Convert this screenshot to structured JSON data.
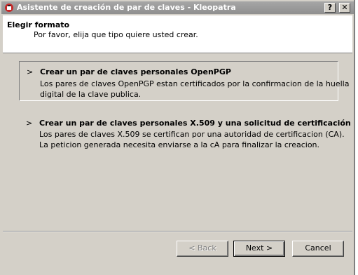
{
  "window": {
    "title": "Asistente de creación de par de claves - Kleopatra",
    "help_label": "?",
    "close_label": "✕"
  },
  "header": {
    "title": "Elegir formato",
    "subtitle": "Por favor, elija que tipo quiere usted crear."
  },
  "options": [
    {
      "chevron": ">",
      "title": "Crear un par de claves personales OpenPGP",
      "desc_line1": "Los pares de claves OpenPGP estan certificados por la confirmacion de la huella",
      "desc_line2": "digital de la clave publica."
    },
    {
      "chevron": ">",
      "title": "Crear un par de claves personales X.509 y una solicitud de certificación",
      "desc_line1": "Los pares de claves X.509 se certifican por una autoridad de certificacion (CA).",
      "desc_line2": "La peticion generada necesita enviarse a la cA para finalizar la creacion."
    }
  ],
  "buttons": {
    "back": "< Back",
    "next": "Next >",
    "cancel": "Cancel"
  }
}
